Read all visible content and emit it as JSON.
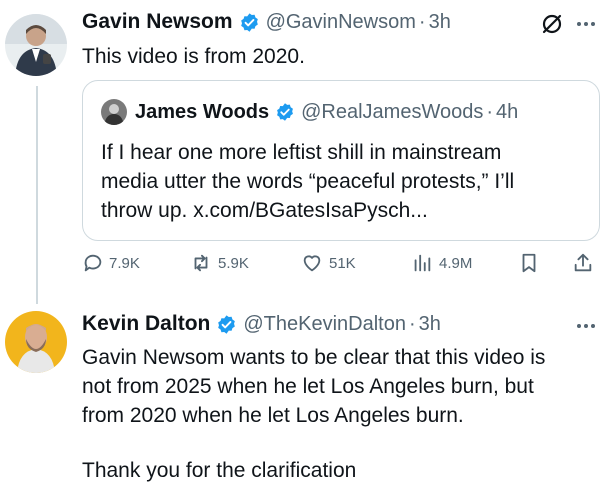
{
  "tweet1": {
    "name": "Gavin Newsom",
    "handle": "@GavinNewsom",
    "time": "3h",
    "text": "This video is from 2020.",
    "avatar_icon": "avatar-photo-icon"
  },
  "quote": {
    "name": "James Woods",
    "handle": "@RealJamesWoods",
    "time": "4h",
    "text_line1": "If I hear one more leftist shill in mainstream",
    "text_line2": "media utter the words “peaceful protests,” I’ll",
    "text_line3": "throw up.  x.com/BGatesIsaPysch..."
  },
  "actions": {
    "replies": "7.9K",
    "reposts": "5.9K",
    "likes": "51K",
    "views": "4.9M"
  },
  "tweet2": {
    "name": "Kevin Dalton",
    "handle": "@TheKevinDalton",
    "time": "3h",
    "text_line1": "Gavin Newsom wants to be clear that this video is",
    "text_line2": "not from 2025 when he let Los Angeles burn, but",
    "text_line3": "from 2020 when he let Los Angeles burn.",
    "text_line4": "Thank you for the clarification"
  },
  "separator": "·",
  "colors": {
    "verified": "#1d9bf0",
    "secondary_text": "#536471",
    "border": "#cfd9de"
  }
}
